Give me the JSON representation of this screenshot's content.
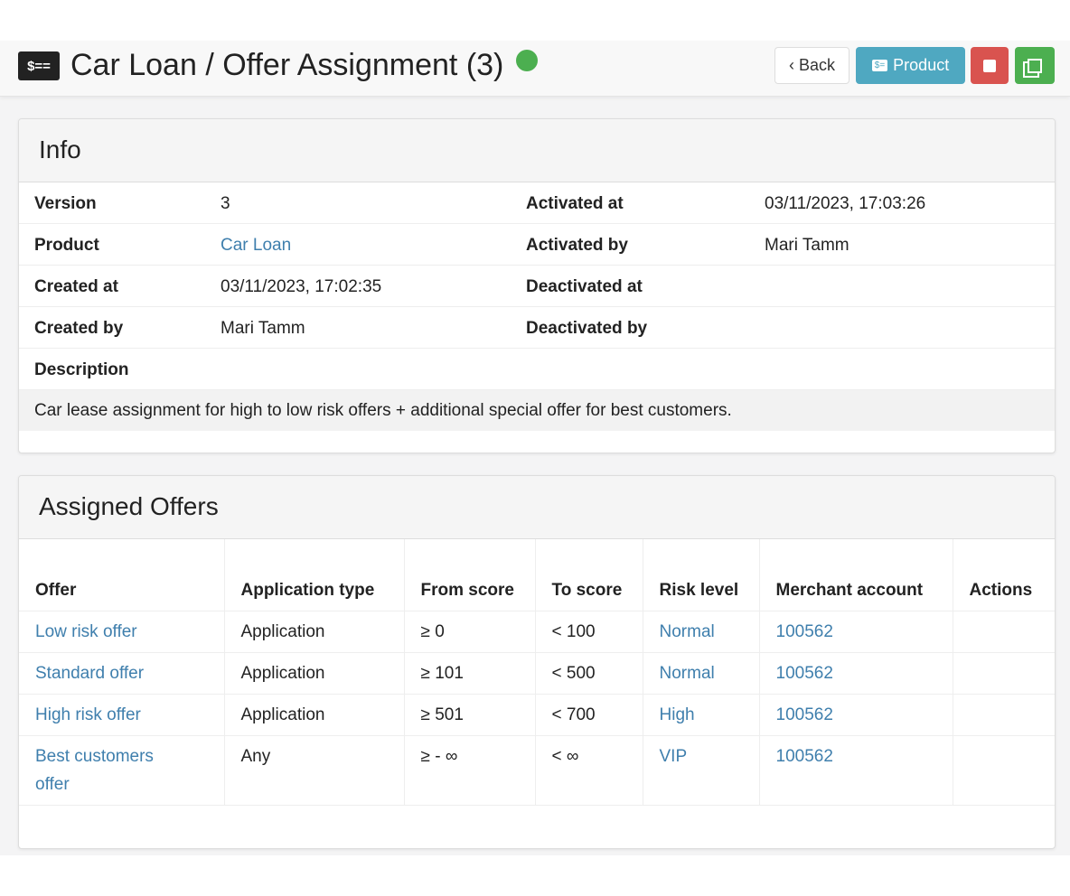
{
  "header": {
    "title": "Car Loan / Offer Assignment (3)",
    "status_color": "#4caf50",
    "logo_icon": "money-bill-icon",
    "back_label": "Back",
    "product_label": "Product"
  },
  "info": {
    "title": "Info",
    "rows": [
      {
        "l1": "Version",
        "v1": "3",
        "l2": "Activated at",
        "v2": "03/11/2023, 17:03:26"
      },
      {
        "l1": "Product",
        "v1": "Car Loan",
        "l2": "Activated by",
        "v2": "Mari Tamm"
      },
      {
        "l1": "Created at",
        "v1": "03/11/2023, 17:02:35",
        "l2": "Deactivated at",
        "v2": ""
      },
      {
        "l1": "Created by",
        "v1": "Mari Tamm",
        "l2": "Deactivated by",
        "v2": ""
      }
    ],
    "description_label": "Description",
    "description": "Car lease assignment for high to low risk offers + additional special offer for best customers."
  },
  "offers": {
    "title": "Assigned Offers",
    "columns": [
      "Offer",
      "Application type",
      "From score",
      "To score",
      "Risk level",
      "Merchant account",
      "Actions"
    ],
    "rows": [
      [
        "Low risk offer",
        "Application",
        "≥ 0",
        "< 100",
        "Normal",
        "100562",
        ""
      ],
      [
        "Standard offer",
        "Application",
        "≥ 101",
        "< 500",
        "Normal",
        "100562",
        ""
      ],
      [
        "High risk offer",
        "Application",
        "≥ 501",
        "< 700",
        "High",
        "100562",
        ""
      ],
      [
        "Best customers offer",
        "Any",
        "≥ - ∞",
        "< ∞",
        "VIP",
        "100562",
        ""
      ]
    ]
  }
}
